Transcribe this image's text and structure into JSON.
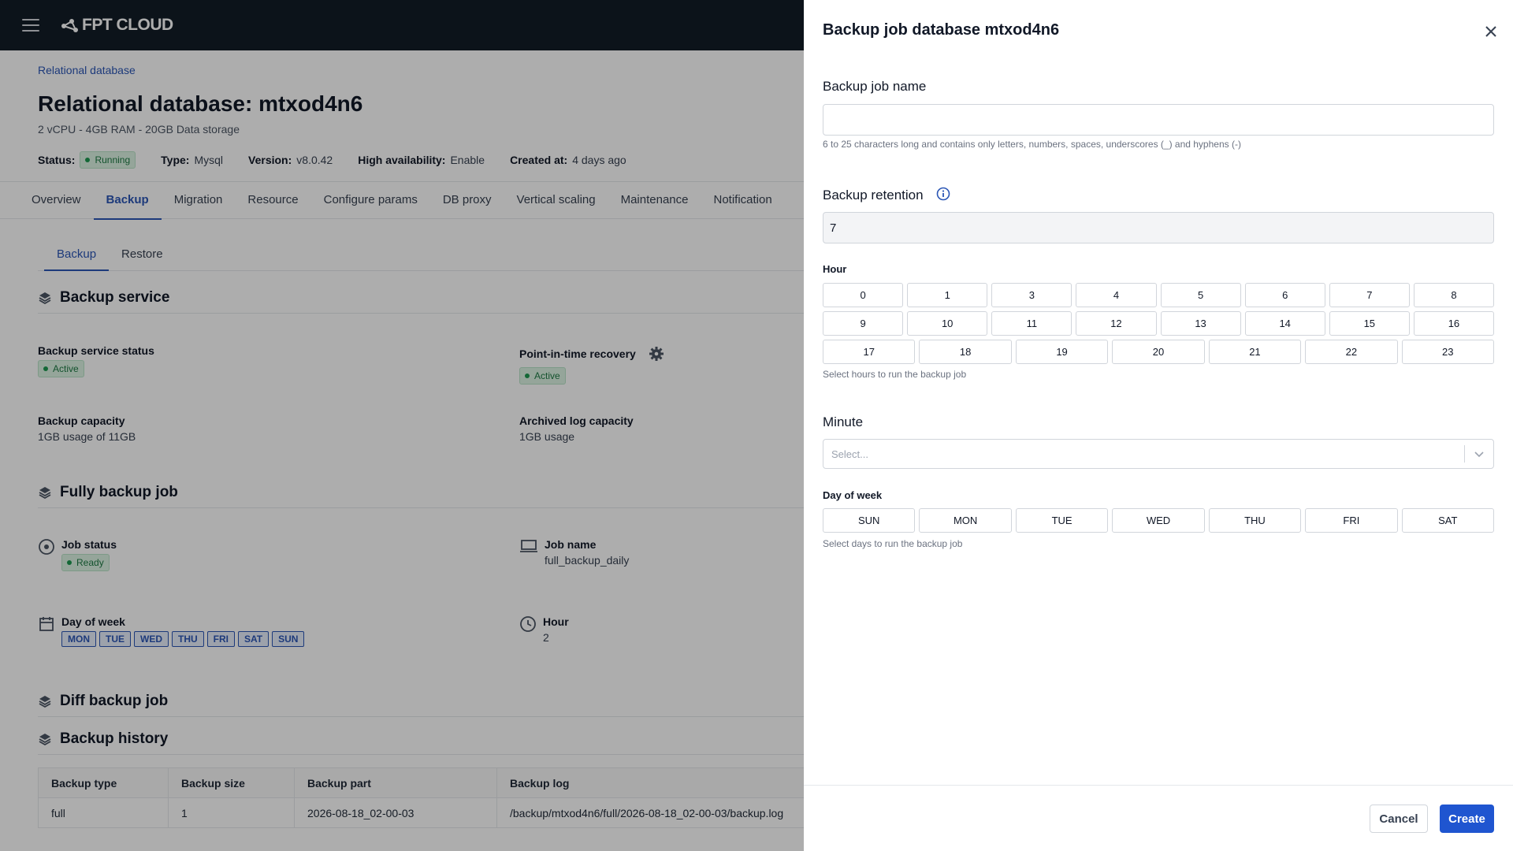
{
  "topbar": {
    "logo": "FPT CLOUD"
  },
  "page": {
    "breadcrumb": "Relational database",
    "title": "Relational database: mtxod4n6",
    "subtitle": "2 vCPU - 4GB RAM - 20GB Data storage",
    "meta": {
      "status_label": "Status:",
      "status_value": "Running",
      "type_label": "Type:",
      "type_value": "Mysql",
      "version_label": "Version:",
      "version_value": "v8.0.42",
      "ha_label": "High availability:",
      "ha_value": "Enable",
      "created_label": "Created at:",
      "created_value": "4 days ago"
    },
    "tabs": [
      "Overview",
      "Backup",
      "Migration",
      "Resource",
      "Configure params",
      "DB proxy",
      "Vertical scaling",
      "Maintenance",
      "Notification"
    ],
    "subtabs": [
      "Backup",
      "Restore"
    ],
    "backup_service": {
      "heading": "Backup service",
      "status_label": "Backup service status",
      "status_value": "Active",
      "pitr_label": "Point-in-time recovery",
      "pitr_value": "Active",
      "capacity_label": "Backup capacity",
      "capacity_value": "1GB usage of 11GB",
      "archived_label": "Archived log capacity",
      "archived_value": "1GB usage"
    },
    "full_backup": {
      "heading": "Fully backup job",
      "job_status_label": "Job status",
      "job_status_value": "Ready",
      "job_name_label": "Job name",
      "job_name_value": "full_backup_daily",
      "day_label": "Day of week",
      "days": [
        "MON",
        "TUE",
        "WED",
        "THU",
        "FRI",
        "SAT",
        "SUN"
      ],
      "hour_label": "Hour",
      "hour_value": "2"
    },
    "diff_heading": "Diff backup job",
    "history": {
      "heading": "Backup history",
      "columns": [
        "Backup type",
        "Backup size",
        "Backup part",
        "Backup log"
      ],
      "rows": [
        [
          "full",
          "1",
          "2026-08-18_02-00-03",
          "/backup/mtxod4n6/full/2026-08-18_02-00-03/backup.log"
        ]
      ]
    }
  },
  "drawer": {
    "title": "Backup job database mtxod4n6",
    "name_label": "Backup job name",
    "name_value": "",
    "name_help": "6 to 25 characters long and contains only letters, numbers, spaces, underscores (_) and hyphens (-)",
    "retention_label": "Backup retention",
    "retention_value": "7",
    "hour_label": "Hour",
    "hours_row1": [
      "0",
      "1",
      "3",
      "4",
      "5",
      "6",
      "7",
      "8"
    ],
    "hours_row2": [
      "9",
      "10",
      "11",
      "12",
      "13",
      "14",
      "15",
      "16"
    ],
    "hours_row3": [
      "17",
      "18",
      "19",
      "20",
      "21",
      "22",
      "23"
    ],
    "hour_help": "Select hours to run the backup job",
    "minute_label": "Minute",
    "minute_placeholder": "Select...",
    "day_label": "Day of week",
    "days": [
      "SUN",
      "MON",
      "TUE",
      "WED",
      "THU",
      "FRI",
      "SAT"
    ],
    "day_help": "Select days to run the backup job",
    "cancel_label": "Cancel",
    "create_label": "Create"
  },
  "colors": {
    "accent": "#1f55d0",
    "topbar": "#131c27",
    "active_badge": "#dcf3e4"
  }
}
